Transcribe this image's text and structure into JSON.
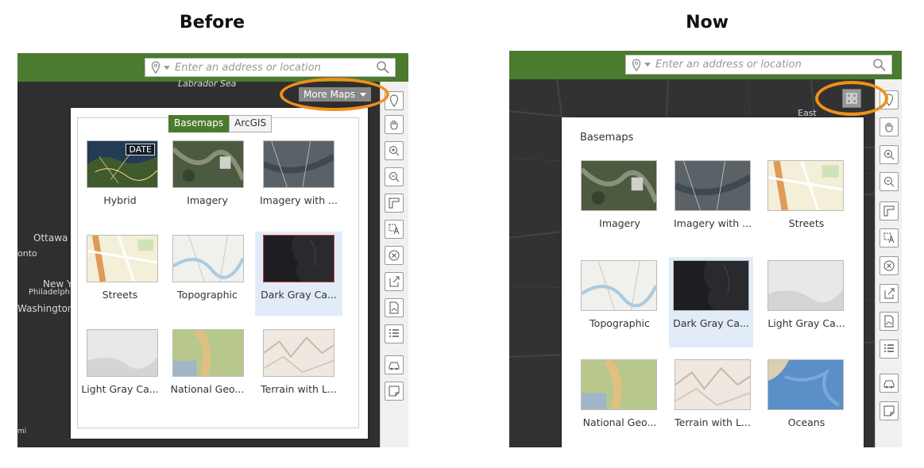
{
  "headings": {
    "before": "Before",
    "now": "Now"
  },
  "search": {
    "placeholder": "Enter an address or location"
  },
  "before": {
    "more_maps_label": "More Maps",
    "tabs": [
      "Basemaps",
      "ArcGIS"
    ],
    "map_labels": [
      "Labrador Sea",
      "Ottawa",
      "onto",
      "New Y",
      "Philadelphia",
      "Washington",
      "mi"
    ],
    "items": [
      {
        "label": "Hybrid",
        "badge": "DATE"
      },
      {
        "label": "Imagery"
      },
      {
        "label": "Imagery with ..."
      },
      {
        "label": "Streets"
      },
      {
        "label": "Topographic"
      },
      {
        "label": "Dark Gray Ca..."
      },
      {
        "label": "Light Gray Ca..."
      },
      {
        "label": "National Geo..."
      },
      {
        "label": "Terrain with L..."
      }
    ]
  },
  "now": {
    "section_title": "Basemaps",
    "map_labels": [
      "East"
    ],
    "items": [
      {
        "label": "Imagery"
      },
      {
        "label": "Imagery with ..."
      },
      {
        "label": "Streets"
      },
      {
        "label": "Topographic"
      },
      {
        "label": "Dark Gray Ca..."
      },
      {
        "label": "Light Gray Ca..."
      },
      {
        "label": "National Geo..."
      },
      {
        "label": "Terrain with L..."
      },
      {
        "label": "Oceans"
      }
    ]
  },
  "colors": {
    "header_green": "#4a7b2e",
    "highlight_orange": "#f0901a",
    "selected_bg": "#e1ecf8",
    "map_dark": "#2f2f2f"
  },
  "icons": [
    "locate-icon",
    "pan-icon",
    "zoom-in-icon",
    "zoom-out-icon",
    "measure-icon",
    "label-icon",
    "clear-icon",
    "share-icon",
    "print-icon",
    "legend-icon",
    "directions-icon",
    "notes-icon"
  ]
}
